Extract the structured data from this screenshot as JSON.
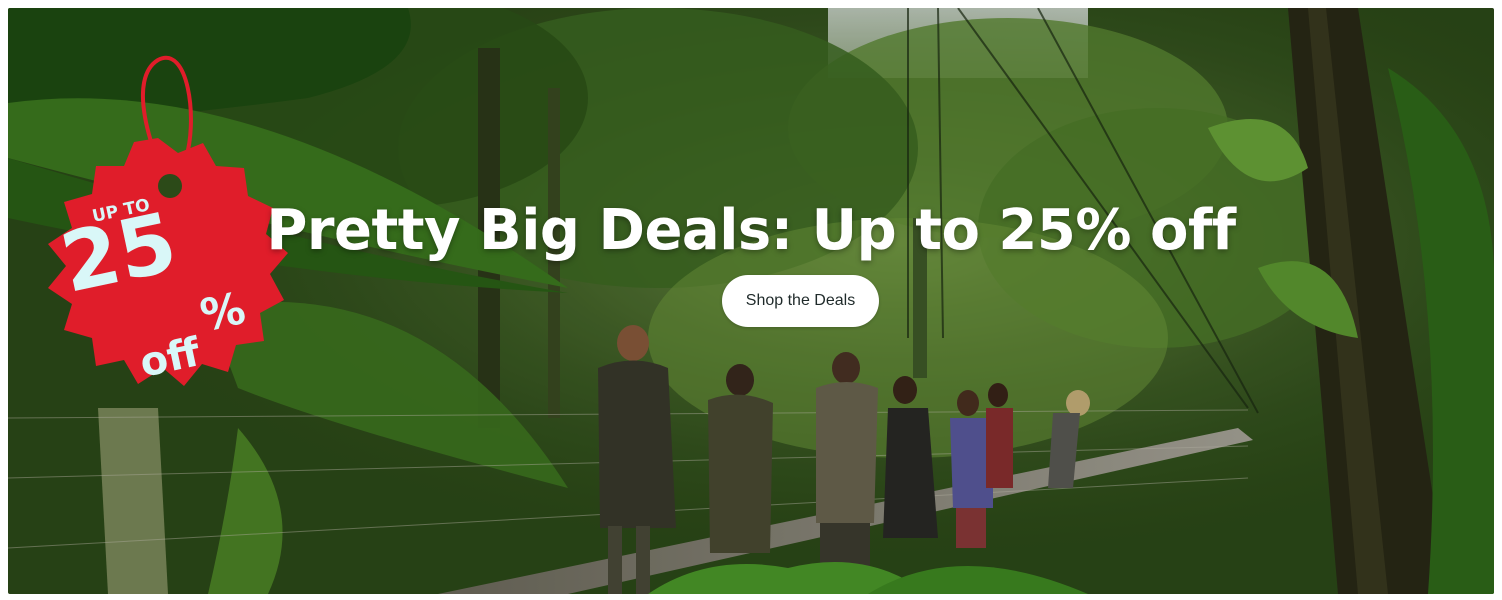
{
  "hero": {
    "headline": "Pretty Big Deals: Up to 25% off",
    "cta_label": "Shop the Deals"
  },
  "badge": {
    "line1": "UP TO",
    "big": "25",
    "percent": "%",
    "off": "off"
  },
  "colors": {
    "badge_red": "#e01d2a",
    "badge_text": "#d9f7f8",
    "foliage_dark": "#1d3a12",
    "foliage_mid": "#3f6b22",
    "sky": "#dfe6e9"
  }
}
